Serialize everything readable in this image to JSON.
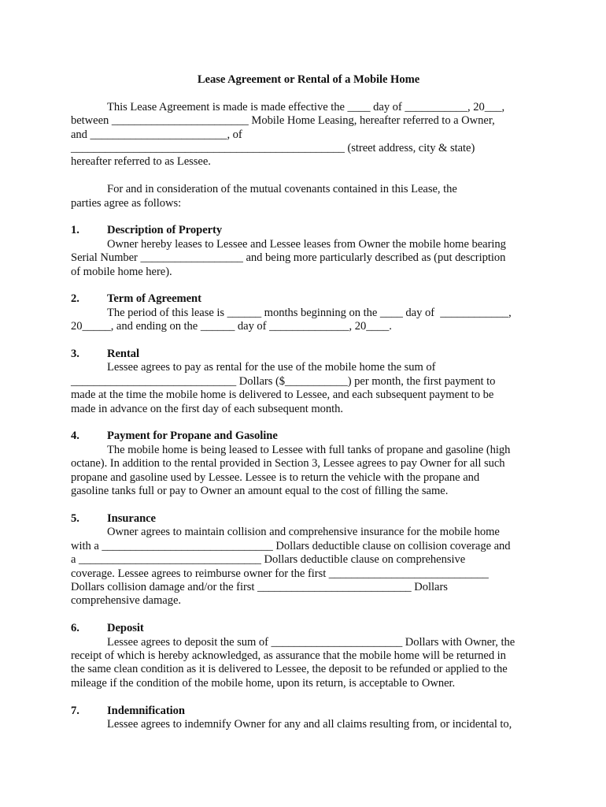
{
  "document": {
    "title": "Lease Agreement or Rental of a Mobile Home",
    "intro": {
      "line1": "This Lease Agreement is made is made effective the ____ day of ___________, 20___,",
      "line2": "between ________________________ Mobile Home Leasing, hereafter referred to a Owner,",
      "line3": "and ________________________, of",
      "line4": "________________________________________________ (street address, city & state)",
      "line5": "hereafter referred to as Lessee."
    },
    "consideration": {
      "line1": "For and in consideration of the mutual covenants contained in this Lease, the",
      "line2": "parties agree as follows:"
    },
    "sections": [
      {
        "number": "1.",
        "heading": "Description of Property",
        "lines": [
          "Owner hereby leases to Lessee and Lessee leases from Owner the mobile home bearing",
          "Serial Number __________________ and being more particularly described as (put description",
          "of mobile home here)."
        ]
      },
      {
        "number": "2.",
        "heading": "Term of Agreement",
        "lines": [
          "The period of this lease is ______ months beginning on the ____ day of  ____________,",
          "20_____, and ending on the ______ day of ______________, 20____."
        ]
      },
      {
        "number": "3.",
        "heading": "Rental",
        "lines": [
          "Lessee agrees to pay as rental for the use of the mobile home the sum of",
          "_____________________________ Dollars ($___________) per month, the first payment to",
          "made at the time the mobile home is delivered to Lessee, and each subsequent payment to be",
          "made in advance on the first day of each subsequent month."
        ]
      },
      {
        "number": "4.",
        "heading": "Payment for Propane and Gasoline",
        "lines": [
          "The mobile home is being leased to Lessee with full tanks of propane and gasoline (high",
          "octane). In addition to the rental provided in Section 3, Lessee agrees to pay Owner for all such",
          "propane and gasoline used by Lessee. Lessee is to return the vehicle with the propane and",
          "gasoline tanks full or pay to Owner an amount equal to the cost of filling the same."
        ]
      },
      {
        "number": "5.",
        "heading": "Insurance",
        "lines": [
          "Owner agrees to maintain collision and comprehensive insurance for the mobile home",
          "with a ______________________________ Dollars deductible clause on collision coverage and",
          "a ________________________________ Dollars deductible clause on comprehensive",
          "coverage. Lessee agrees to reimburse owner for the first ____________________________",
          "Dollars collision damage and/or the first ___________________________ Dollars",
          "comprehensive damage."
        ]
      },
      {
        "number": "6.",
        "heading": "Deposit",
        "lines": [
          "Lessee agrees to deposit the sum of _______________________ Dollars with Owner, the",
          "receipt of which is hereby acknowledged, as assurance that the mobile home will be returned in",
          "the same clean condition as it is delivered to Lessee, the deposit to be refunded or applied to the",
          "mileage if the condition of the mobile home, upon its return, is acceptable to Owner."
        ]
      },
      {
        "number": "7.",
        "heading": "Indemnification",
        "lines": [
          "Lessee agrees to indemnify Owner for any and all claims resulting from, or incidental to,"
        ]
      }
    ]
  }
}
